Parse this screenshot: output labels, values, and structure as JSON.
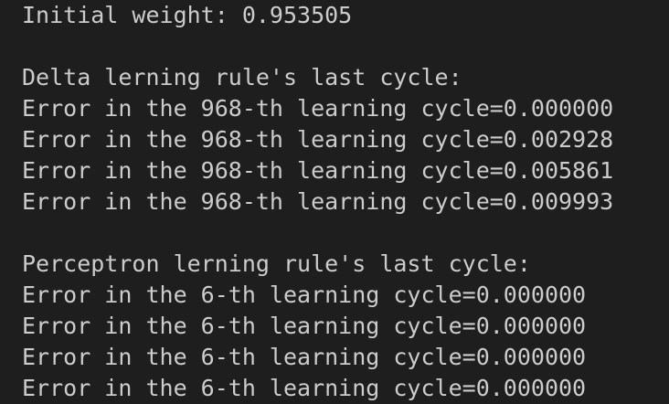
{
  "terminal": {
    "lines": [
      "Initial weight: 0.953505",
      "",
      "Delta lerning rule's last cycle:",
      "Error in the 968-th learning cycle=0.000000",
      "Error in the 968-th learning cycle=0.002928",
      "Error in the 968-th learning cycle=0.005861",
      "Error in the 968-th learning cycle=0.009993",
      "",
      "Perceptron lerning rule's last cycle:",
      "Error in the 6-th learning cycle=0.000000",
      "Error in the 6-th learning cycle=0.000000",
      "Error in the 6-th learning cycle=0.000000",
      "Error in the 6-th learning cycle=0.000000"
    ]
  },
  "colors": {
    "background": "#1e1e1e",
    "text": "#cccccc"
  }
}
